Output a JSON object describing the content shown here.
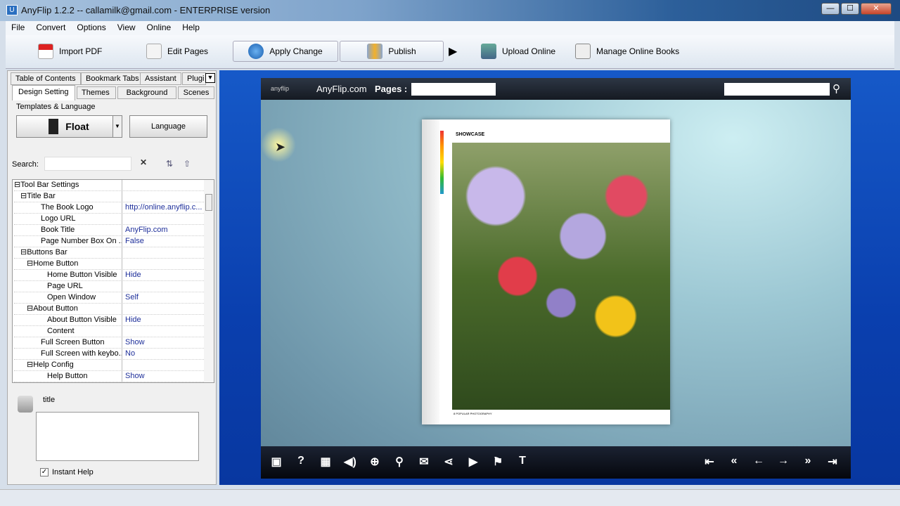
{
  "window": {
    "title": "AnyFlip 1.2.2  -- callamilk@gmail.com - ENTERPRISE version",
    "min": "—",
    "max": "☐",
    "close": "✕"
  },
  "menu": [
    "File",
    "Convert",
    "Options",
    "View",
    "Online",
    "Help"
  ],
  "toolbar": {
    "import_pdf": "Import PDF",
    "edit_pages": "Edit Pages",
    "apply_change": "Apply Change",
    "publish": "Publish",
    "upload_online": "Upload Online",
    "manage_online": "Manage Online Books"
  },
  "tabs_row1": [
    "Table of Contents",
    "Bookmark Tabs",
    "Assistant",
    "Plugi"
  ],
  "tabs_row2": [
    "Design Setting",
    "Themes",
    "Background",
    "Scenes"
  ],
  "templates": {
    "heading": "Templates & Language",
    "template": "Float",
    "language": "Language"
  },
  "search": {
    "label": "Search:",
    "value": ""
  },
  "properties": [
    {
      "k": "Tool Bar Settings",
      "v": "",
      "lvl": 0,
      "grp": true
    },
    {
      "k": "Title Bar",
      "v": "",
      "lvl": 1,
      "grp": true
    },
    {
      "k": "The Book Logo",
      "v": "http://online.anyflip.c...",
      "lvl": 2
    },
    {
      "k": "Logo URL",
      "v": "",
      "lvl": 2
    },
    {
      "k": "Book Title",
      "v": "AnyFlip.com",
      "lvl": 2
    },
    {
      "k": "Page Number Box On ...",
      "v": "False",
      "lvl": 2
    },
    {
      "k": "Buttons Bar",
      "v": "",
      "lvl": 1,
      "grp": true
    },
    {
      "k": "Home Button",
      "v": "",
      "lvl": 2,
      "grp": true
    },
    {
      "k": "Home Button Visible",
      "v": "Hide",
      "lvl": 3
    },
    {
      "k": "Page URL",
      "v": "",
      "lvl": 3
    },
    {
      "k": "Open Window",
      "v": "Self",
      "lvl": 3
    },
    {
      "k": "About Button",
      "v": "",
      "lvl": 2,
      "grp": true
    },
    {
      "k": "About Button Visible",
      "v": "Hide",
      "lvl": 3
    },
    {
      "k": "Content",
      "v": "",
      "lvl": 3
    },
    {
      "k": "Full Screen Button",
      "v": "Show",
      "lvl": 2
    },
    {
      "k": "Full Screen with keybo...",
      "v": "No",
      "lvl": 2
    },
    {
      "k": "Help Config",
      "v": "",
      "lvl": 2,
      "grp": true
    },
    {
      "k": "Help Button",
      "v": "Show",
      "lvl": 3
    }
  ],
  "help": {
    "title": "title",
    "instant_help": "Instant Help"
  },
  "viewer": {
    "logo": "anyflip",
    "book_title": "AnyFlip.com",
    "pages_label": "Pages :",
    "showcase": "SHOWCASE",
    "footer": "8  POPULAR PHOTOGRAPHY"
  },
  "viewer_icons": [
    "fullscreen-icon",
    "help-icon",
    "thumbnails-icon",
    "sound-icon",
    "zoom-in-icon",
    "search-icon",
    "email-icon",
    "share-icon",
    "autoflip-icon",
    "bookmark-icon",
    "text-icon"
  ],
  "viewer_icon_glyphs": [
    "▣",
    "?",
    "▦",
    "◀)",
    "⊕",
    "⚲",
    "✉",
    "⋖",
    "▶",
    "⚑",
    "T"
  ],
  "nav_icons": [
    "first-page-icon",
    "previous-page-icon",
    "back-icon",
    "forward-icon",
    "next-page-icon",
    "last-page-icon"
  ],
  "nav_glyphs": [
    "⇤",
    "«",
    "←",
    "→",
    "»",
    "⇥"
  ]
}
